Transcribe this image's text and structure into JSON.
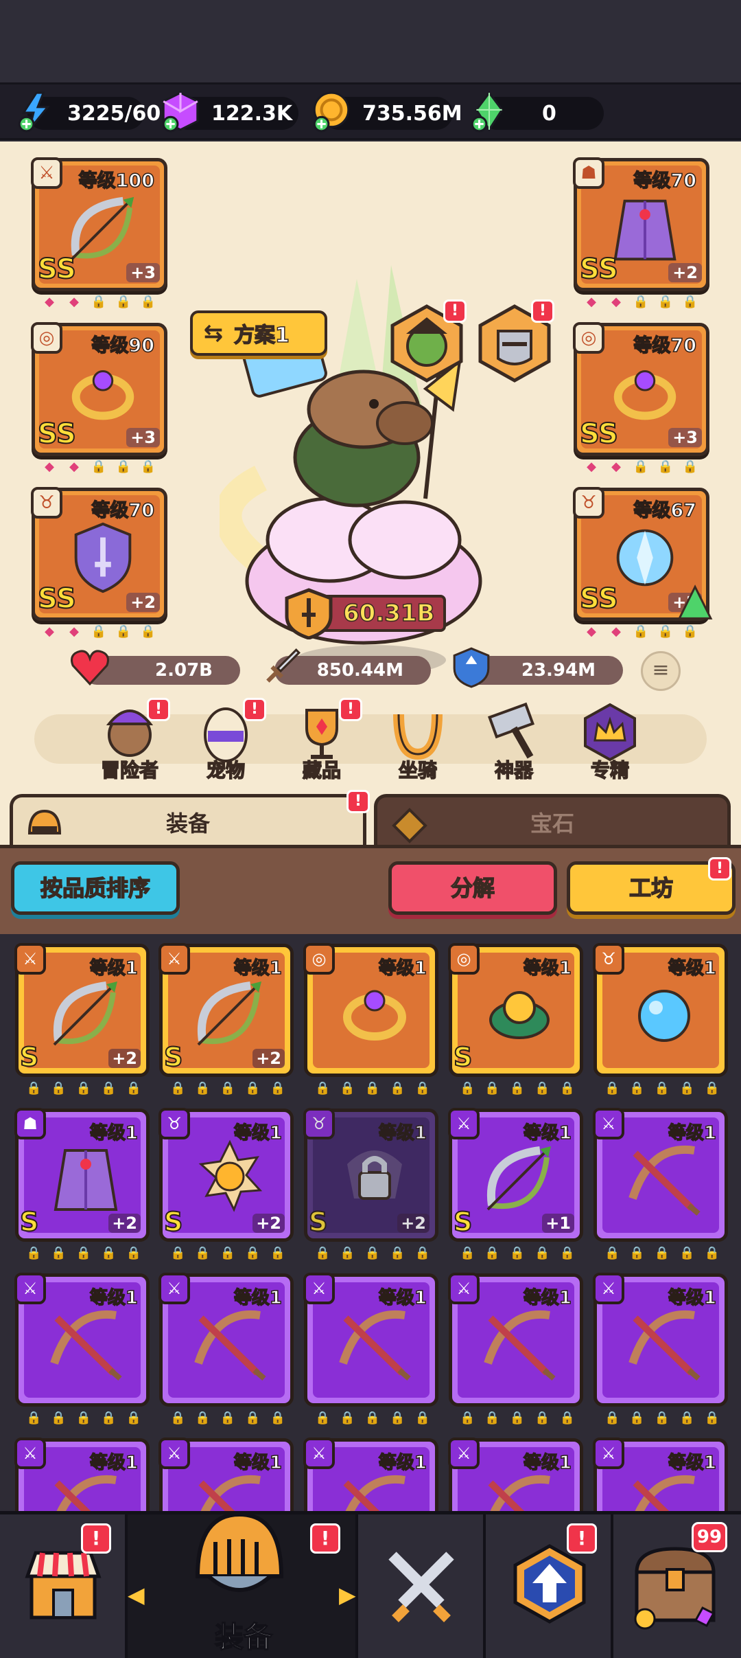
{
  "resources": [
    {
      "name": "energy",
      "value": "3225/60",
      "icon": "lightning-icon",
      "color": "#3aa6ff"
    },
    {
      "name": "gems",
      "value": "122.3K",
      "icon": "purple-gem-icon",
      "color": "#c64cff"
    },
    {
      "name": "gold",
      "value": "735.56M",
      "icon": "gold-coin-icon",
      "color": "#ffb52e"
    },
    {
      "name": "crystal",
      "value": "0",
      "icon": "green-crystal-icon",
      "color": "#4ed36a"
    }
  ],
  "plan_label": "方案1",
  "equipped_left": [
    {
      "level": "等级100",
      "grade": "SS",
      "plus": "+3",
      "type": "bow",
      "badge": "sword-icon"
    },
    {
      "level": "等级90",
      "grade": "SS",
      "plus": "+3",
      "type": "ring",
      "badge": "ring-icon"
    },
    {
      "level": "等级70",
      "grade": "SS",
      "plus": "+2",
      "type": "emblem",
      "badge": "necklace-icon"
    }
  ],
  "equipped_right": [
    {
      "level": "等级70",
      "grade": "SS",
      "plus": "+2",
      "type": "cloak",
      "badge": "armor-icon"
    },
    {
      "level": "等级70",
      "grade": "SS",
      "plus": "+3",
      "type": "ring",
      "badge": "ring-icon"
    },
    {
      "level": "等级67",
      "grade": "SS",
      "plus": "+2",
      "type": "crystal",
      "badge": "necklace-icon"
    }
  ],
  "combat_power": "60.31B",
  "stats": {
    "hp": "2.07B",
    "attack": "850.44M",
    "defense": "23.94M"
  },
  "menu": [
    {
      "label": "冒险者",
      "icon": "adventurer-icon",
      "alert": "!"
    },
    {
      "label": "宠物",
      "icon": "pet-egg-icon",
      "alert": "!"
    },
    {
      "label": "藏品",
      "icon": "trophy-icon",
      "alert": "!"
    },
    {
      "label": "坐骑",
      "icon": "horseshoe-icon",
      "alert": ""
    },
    {
      "label": "神器",
      "icon": "hammer-icon",
      "alert": ""
    },
    {
      "label": "专精",
      "icon": "crown-icon",
      "alert": ""
    }
  ],
  "tabs": {
    "equipment": "装备",
    "gems": "宝石",
    "alert": "!"
  },
  "buttons": {
    "sort": "按品质排序",
    "dismantle": "分解",
    "workshop": "工坊",
    "workshop_alert": "!"
  },
  "inventory": [
    {
      "level": "等级1",
      "grade": "S",
      "plus": "+2",
      "rarity": "o",
      "type": "bow",
      "badge": "sword-icon"
    },
    {
      "level": "等级1",
      "grade": "S",
      "plus": "+2",
      "rarity": "o",
      "type": "bow",
      "badge": "sword-icon"
    },
    {
      "level": "等级1",
      "grade": "",
      "plus": "",
      "rarity": "o",
      "type": "ring",
      "badge": "ring-icon"
    },
    {
      "level": "等级1",
      "grade": "S",
      "plus": "",
      "rarity": "o",
      "type": "amulet",
      "badge": "ring-icon"
    },
    {
      "level": "等级1",
      "grade": "",
      "plus": "",
      "rarity": "o",
      "type": "orb",
      "badge": "necklace-icon"
    },
    {
      "level": "等级1",
      "grade": "S",
      "plus": "+2",
      "rarity": "p",
      "type": "cloak",
      "badge": "armor-icon"
    },
    {
      "level": "等级1",
      "grade": "S",
      "plus": "+2",
      "rarity": "p",
      "type": "sun",
      "badge": "necklace-icon"
    },
    {
      "level": "等级1",
      "grade": "S",
      "plus": "+2",
      "rarity": "d",
      "type": "locked",
      "badge": "necklace-icon"
    },
    {
      "level": "等级1",
      "grade": "S",
      "plus": "+1",
      "rarity": "p",
      "type": "bow",
      "badge": "sword-icon"
    },
    {
      "level": "等级1",
      "grade": "",
      "plus": "",
      "rarity": "p",
      "type": "crossbow",
      "badge": "sword-icon"
    },
    {
      "level": "等级1",
      "grade": "",
      "plus": "",
      "rarity": "p",
      "type": "crossbow",
      "badge": "sword-icon"
    },
    {
      "level": "等级1",
      "grade": "",
      "plus": "",
      "rarity": "p",
      "type": "crossbow",
      "badge": "sword-icon"
    },
    {
      "level": "等级1",
      "grade": "",
      "plus": "",
      "rarity": "p",
      "type": "crossbow",
      "badge": "sword-icon"
    },
    {
      "level": "等级1",
      "grade": "",
      "plus": "",
      "rarity": "p",
      "type": "crossbow",
      "badge": "sword-icon"
    },
    {
      "level": "等级1",
      "grade": "",
      "plus": "",
      "rarity": "p",
      "type": "crossbow",
      "badge": "sword-icon"
    },
    {
      "level": "等级1",
      "grade": "",
      "plus": "",
      "rarity": "p",
      "type": "crossbow",
      "badge": "sword-icon"
    },
    {
      "level": "等级1",
      "grade": "",
      "plus": "",
      "rarity": "p",
      "type": "crossbow",
      "badge": "sword-icon"
    },
    {
      "level": "等级1",
      "grade": "",
      "plus": "",
      "rarity": "p",
      "type": "crossbow",
      "badge": "sword-icon"
    },
    {
      "level": "等级1",
      "grade": "",
      "plus": "",
      "rarity": "p",
      "type": "crossbow",
      "badge": "sword-icon"
    },
    {
      "level": "等级1",
      "grade": "",
      "plus": "",
      "rarity": "p",
      "type": "crossbow",
      "badge": "sword-icon"
    }
  ],
  "nav": {
    "active_label": "装备",
    "alert": "!",
    "chest_count": "99"
  }
}
